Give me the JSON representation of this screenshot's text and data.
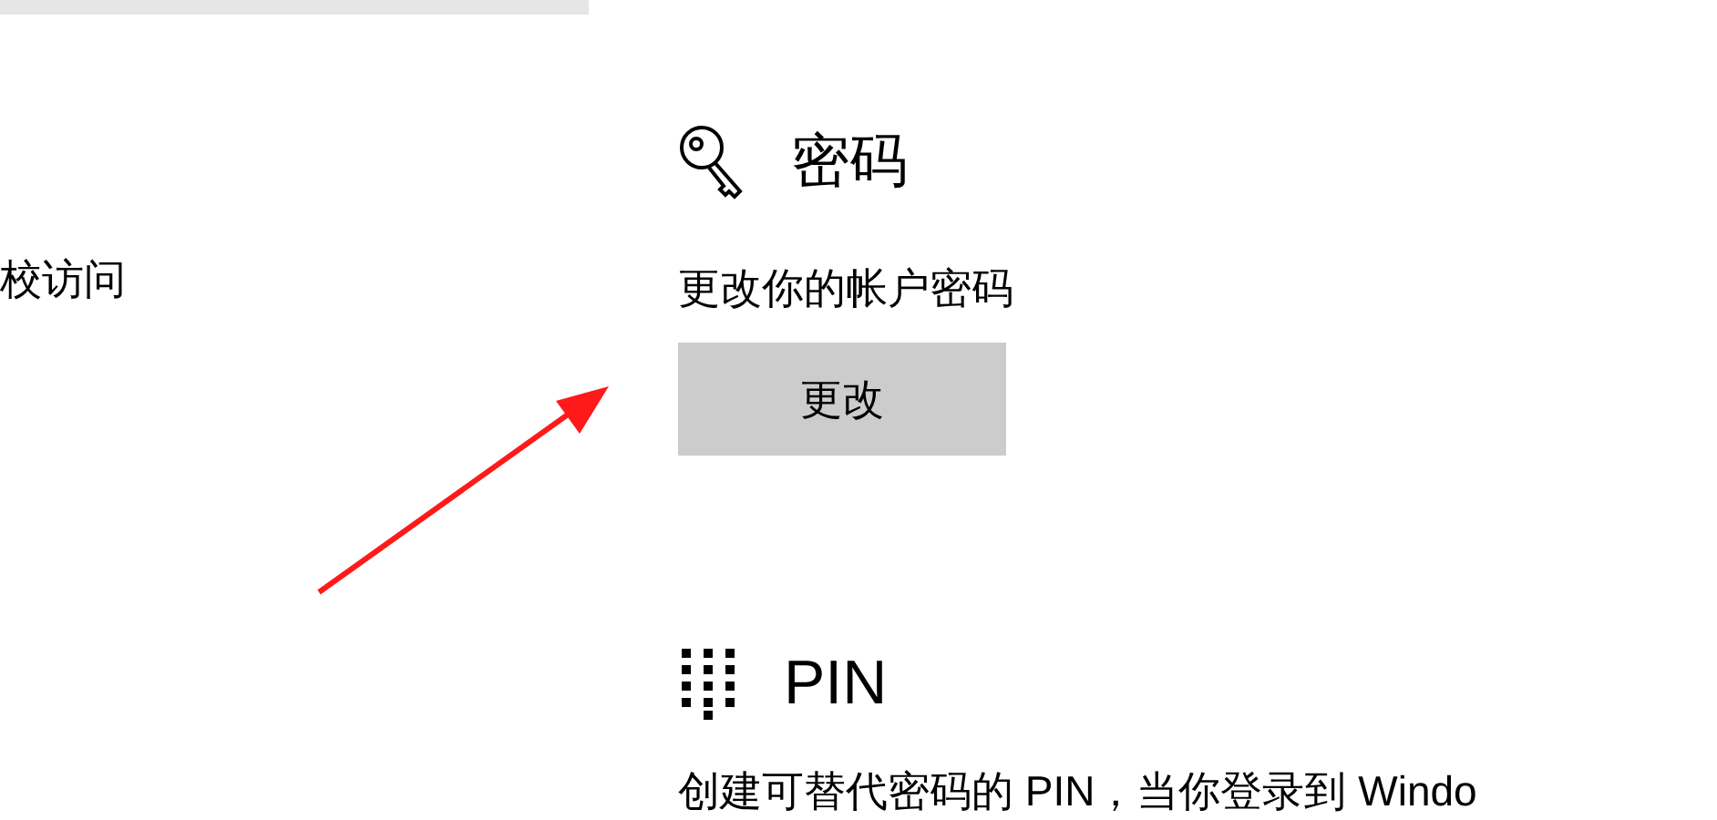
{
  "sidebar": {
    "item_label": "校访问"
  },
  "password": {
    "title": "密码",
    "description": "更改你的帐户密码",
    "button": "更改"
  },
  "pin": {
    "title": "PIN",
    "description": "创建可替代密码的 PIN，当你登录到 Windo"
  },
  "annotation": {
    "kind": "arrow",
    "color": "#ff1a1a"
  }
}
